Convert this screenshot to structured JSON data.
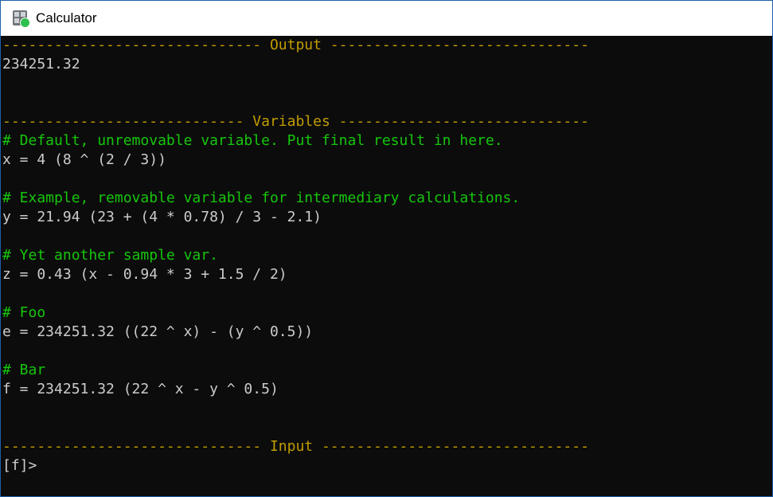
{
  "window": {
    "title": "Calculator"
  },
  "colors": {
    "background": "#0c0c0c",
    "text": "#cccccc",
    "separator": "#c19c00",
    "comment": "#16c60c"
  },
  "output": {
    "header": "------------------------------ Output ------------------------------",
    "value": "234251.32"
  },
  "variables": {
    "header": "---------------------------- Variables -----------------------------",
    "items": [
      {
        "comment": "# Default, unremovable variable. Put final result in here.",
        "expr": "x = 4 (8 ^ (2 / 3))"
      },
      {
        "comment": "# Example, removable variable for intermediary calculations.",
        "expr": "y = 21.94 (23 + (4 * 0.78) / 3 - 2.1)"
      },
      {
        "comment": "# Yet another sample var.",
        "expr": "z = 0.43 (x - 0.94 * 3 + 1.5 / 2)"
      },
      {
        "comment": "# Foo",
        "expr": "e = 234251.32 ((22 ^ x) - (y ^ 0.5))"
      },
      {
        "comment": "# Bar",
        "expr": "f = 234251.32 (22 ^ x - y ^ 0.5)"
      }
    ]
  },
  "input": {
    "header": "------------------------------ Input -------------------------------",
    "prompt": "[f]>"
  }
}
